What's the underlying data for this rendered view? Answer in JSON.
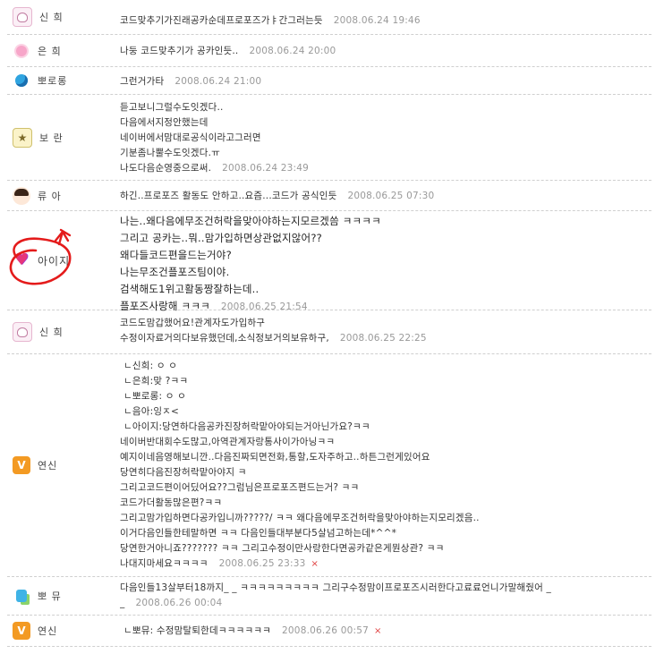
{
  "comments": [
    {
      "author": "신 희",
      "avatar": "cat-icon",
      "lines": [
        "코드맞추기가진래공카순데프로포즈가ㅑ간그러는듯"
      ],
      "date": "2008.06.24 19:46"
    },
    {
      "author": "은 희",
      "avatar": "candy-icon",
      "lines": [
        "나둥 코드맞추기가 공카인듯.."
      ],
      "date": "2008.06.24 20:00"
    },
    {
      "author": "뽀로롱",
      "avatar": "blue-blob-icon",
      "lines": [
        "그런거가타"
      ],
      "date": "2008.06.24 21:00"
    },
    {
      "author": "보 란",
      "avatar": "star-icon",
      "lines": [
        "듣고보니그럴수도잇겠다..",
        "다음에서지정안했는데",
        "네이버에서맘대로공식이라고그러면",
        "기분좀나뿔수도잇겠다.ㅠ",
        "나도다음순영중으로써."
      ],
      "date": "2008.06.24 23:49"
    },
    {
      "author": "류 아",
      "avatar": "girl-icon",
      "lines": [
        "하긴..프로포즈 활동도 안하고..요즘...코드가 공식인듯"
      ],
      "date": "2008.06.25 07:30"
    },
    {
      "author": "아이지",
      "avatar": "heart-icon",
      "lines": [
        "나는..왜다음에무조건허락을맞아야하는지모르겠씀 ㅋㅋㅋㅋ",
        "그리고 공카는..뭐..맘가입하면상관없지않어??",
        "왜다들코드편을드는거야?",
        "나는무조건플포즈팀이야.",
        "검색해도1위고활동짱잘하는데..",
        "플포즈사랑해 ㅋㅋㅋ"
      ],
      "date": "2008.06.25 21:54"
    },
    {
      "author": "신 희",
      "avatar": "cat-icon",
      "lines": [
        "코드도맘갑했어요!관계자도가입하구",
        "수정이자료거의다보유했던데,소식정보거의보유하구,"
      ],
      "date": "2008.06.25 22:25"
    },
    {
      "author": "연신",
      "avatar": "v-icon",
      "lines": [
        "ㄴ신희: ㅇ ㅇ",
        "ㄴ은희:맞 ?ㅋㅋ",
        "ㄴ뽀로롱: ㅇ ㅇ",
        "ㄴ음아:잉ㅈ<",
        "ㄴ아이지:당연하다음공카진장허락맡아야되는거아닌가요?ㅋㅋ",
        "네이버반대회수도많고,아역관계자랑통사이가아닝ㅋㅋ",
        "예지이네음영해보니깐..다음진짜되면전화,통할,도자주하고..하튼그런게있어요",
        "당연히다음진장허락맡아야지 ㅋ",
        "그리고코드편이어딨어요??그럼님은프로포즈편드는거? ㅋㅋ",
        "코드가더활동많은편?ㅋㅋ",
        "그리고맘가입하면다공카입니까?????/ ㅋㅋ 왜다음에무조건허락을맞아야하는지모리겠음..",
        "이거다음인들한테말하면 ㅋㅋ 다음인들대부분다5살넘고하는데*^^*",
        "당연한거아니죠??????? ㅋㅋ 그리고수정이만사랑한다면공카같은게뭔상관? ㅋㅋ",
        "나대지마세요ㅋㅋㅋㅋ"
      ],
      "date": "2008.06.25 23:33",
      "delete": "×"
    },
    {
      "author": "뽀 뮤",
      "avatar": "robot-icon",
      "lines": [
        "다음인들13살부터18까지_ _ ㅋㅋㅋㅋㅋㅋㅋㅋㅋ 그리구수정맘이프로포즈시러한다고료료언니가말해줬어 _",
        "_"
      ],
      "date": "2008.06.26 00:04"
    },
    {
      "author": "연신",
      "avatar": "v-icon",
      "lines": [
        "ㄴ뽀뮤: 수정맘탈퇴한데ㅋㅋㅋㅋㅋㅋ"
      ],
      "date": "2008.06.26 00:57",
      "delete": "×"
    }
  ]
}
